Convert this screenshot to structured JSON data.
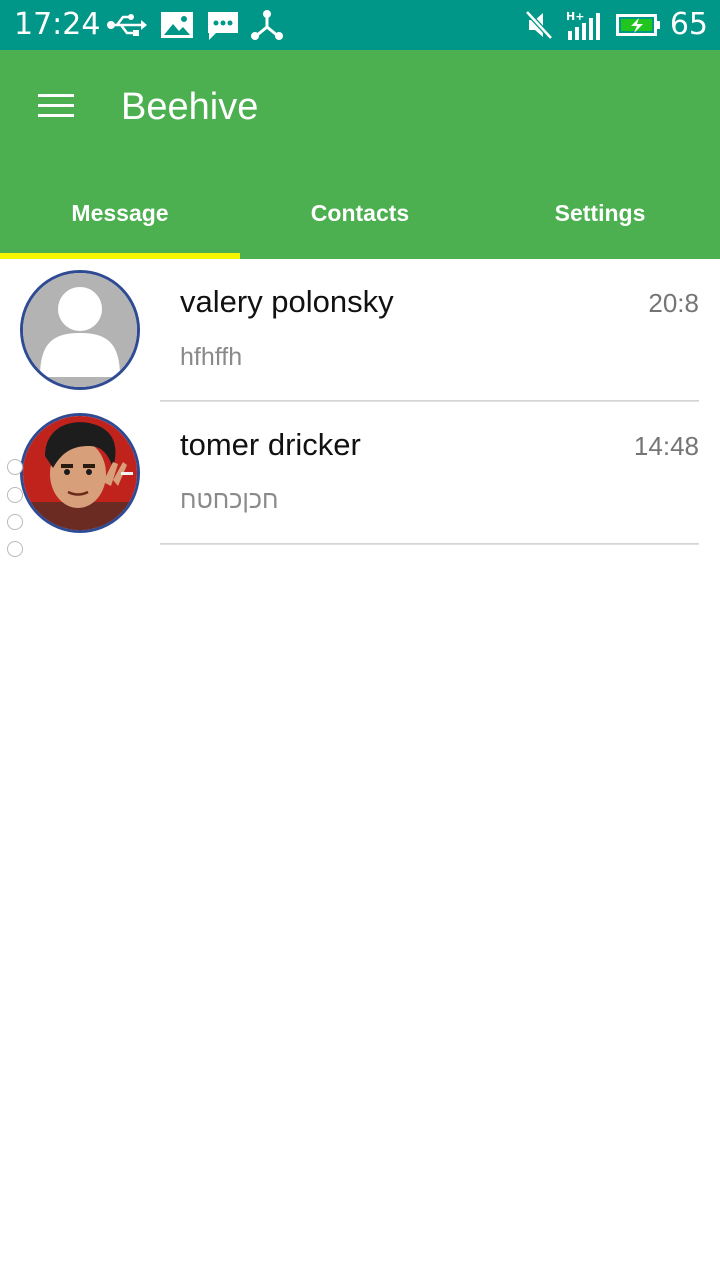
{
  "status_bar": {
    "time": "17:24",
    "battery_level": "65",
    "left_icons": [
      "usb-icon",
      "image-notification-icon",
      "message-notification-icon",
      "share-icon"
    ],
    "right_icons": [
      "muted-speaker-icon",
      "signal-hplus-icon",
      "battery-charging-icon"
    ],
    "network_type": "H+",
    "colors": {
      "background": "#009688",
      "battery_fill": "#22c51e"
    }
  },
  "app_bar": {
    "title": "Beehive",
    "menu_icon": "hamburger-menu-icon",
    "colors": {
      "background": "#4caf50",
      "tab_indicator": "#f5f500"
    }
  },
  "tabs": [
    {
      "label": "Message",
      "selected": true
    },
    {
      "label": "Contacts",
      "selected": false
    },
    {
      "label": "Settings",
      "selected": false
    }
  ],
  "conversations": [
    {
      "name": "valery polonsky",
      "time": "20:8",
      "preview": "hfhffh",
      "avatar": "default-avatar-icon"
    },
    {
      "name": "tomer dricker",
      "time": "14:48",
      "preview": "חכןכחטח",
      "avatar": "cartoon-avatar"
    }
  ]
}
